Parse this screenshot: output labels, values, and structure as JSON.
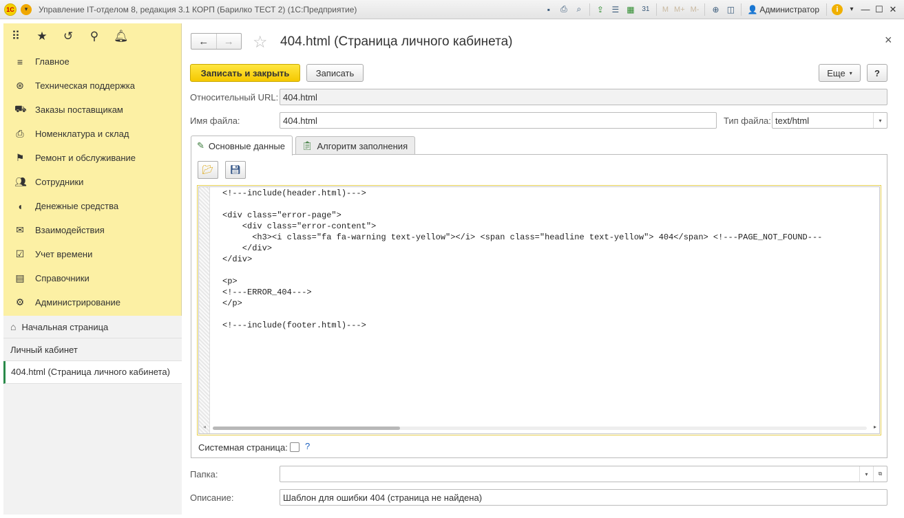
{
  "titlebar": {
    "logo": "1С",
    "title": "Управление IT-отделом 8, редакция 3.1 КОРП (Барилко ТЕСТ 2)  (1С:Предприятие)",
    "m_labels": [
      "M",
      "M+",
      "M-"
    ],
    "user": "Администратор",
    "icons": [
      "save-icon",
      "print-icon",
      "preview-icon",
      "upload-icon",
      "print-list-icon",
      "calculator-icon",
      "calendar-icon",
      "zoom-icon",
      "panel-icon",
      "user-icon",
      "info-icon"
    ]
  },
  "quickbar": {
    "icons": [
      "apps-grid-icon",
      "star-icon",
      "history-icon",
      "search-icon",
      "bell-icon"
    ]
  },
  "sections": [
    {
      "label": "Главное",
      "icon": "menu-icon"
    },
    {
      "label": "Техническая поддержка",
      "icon": "lifebuoy-icon"
    },
    {
      "label": "Заказы поставщикам",
      "icon": "truck-icon"
    },
    {
      "label": "Номенклатура и склад",
      "icon": "printer-icon"
    },
    {
      "label": "Ремонт и обслуживание",
      "icon": "flag-icon"
    },
    {
      "label": "Сотрудники",
      "icon": "people-icon"
    },
    {
      "label": "Денежные средства",
      "icon": "money-bag-icon"
    },
    {
      "label": "Взаимодействия",
      "icon": "mail-icon"
    },
    {
      "label": "Учет времени",
      "icon": "calendar-check-icon"
    },
    {
      "label": "Справочники",
      "icon": "books-icon"
    },
    {
      "label": "Администрирование",
      "icon": "gear-icon"
    }
  ],
  "navlist": {
    "home": "Начальная страница",
    "item": "Личный кабинет",
    "active": "404.html (Страница личного кабинета)"
  },
  "form": {
    "title": "404.html (Страница личного кабинета)",
    "btn_save_close": "Записать и закрыть",
    "btn_save": "Записать",
    "btn_more": "Еще",
    "btn_help": "?",
    "url_label": "Относительный URL:",
    "url_value": "404.html",
    "file_label": "Имя файла:",
    "file_value": "404.html",
    "type_label": "Тип файла:",
    "type_value": "text/html",
    "tab_main": "Основные данные",
    "tab_algo": "Алгоритм заполнения",
    "code_lines": [
      "<!---include(header.html)--->",
      "",
      "<div class=\"error-page\">",
      "    <div class=\"error-content\">",
      "      <h3><i class=\"fa fa-warning text-yellow\"></i> <span class=\"headline text-yellow\"> 404</span> <!---PAGE_NOT_FOUND---",
      "    </div>",
      "</div>",
      "",
      "<p>",
      "<!---ERROR_404--->",
      "</p>",
      "",
      "<!---include(footer.html)--->"
    ],
    "system_label": "Системная страница:",
    "system_checked": false,
    "system_help": "?",
    "folder_label": "Папка:",
    "folder_value": "",
    "desc_label": "Описание:",
    "desc_value": "Шаблон для ошибки 404 (страница не найдена)"
  },
  "colors": {
    "panel": "#fcf0a4",
    "primary_button": "#f5c800",
    "accent_link": "#1a5fbf"
  }
}
